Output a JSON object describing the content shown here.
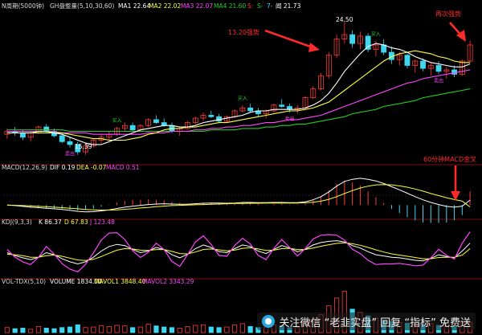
{
  "chart_data": [
    {
      "type": "candlestick",
      "panel": "main",
      "header": {
        "title": "N周期(5000钟)",
        "params": "GH盘整量(5,10,30,60)",
        "ma1": "MA1 22.64",
        "ma2": "MA2 22.02",
        "ma3": "MA3 22.07",
        "ma4": "MA4 21.60",
        "b": "S:",
        "s": "S-",
        "f": "7-",
        "p": "闻 21.73"
      },
      "high_label": "24.50",
      "low_label": "15.39",
      "annotations": [
        "13.20强势",
        "再次强势"
      ],
      "signal_labels": [
        "买入",
        "卖出"
      ],
      "candles": [
        [
          16.8,
          17.2,
          16.5,
          17.0
        ],
        [
          17.0,
          17.3,
          16.7,
          16.9
        ],
        [
          16.9,
          17.1,
          16.4,
          16.6
        ],
        [
          16.6,
          17.0,
          16.3,
          16.9
        ],
        [
          16.9,
          17.4,
          16.8,
          17.3
        ],
        [
          17.3,
          17.5,
          16.9,
          17.0
        ],
        [
          17.0,
          17.2,
          16.6,
          16.7
        ],
        [
          16.7,
          16.9,
          16.2,
          16.3
        ],
        [
          16.3,
          16.6,
          15.9,
          16.1
        ],
        [
          16.1,
          16.3,
          15.4,
          15.6
        ],
        [
          15.6,
          16.2,
          15.4,
          16.0
        ],
        [
          16.0,
          16.5,
          15.9,
          16.4
        ],
        [
          16.4,
          16.8,
          16.2,
          16.6
        ],
        [
          16.6,
          17.0,
          16.4,
          16.8
        ],
        [
          16.8,
          17.3,
          16.7,
          17.2
        ],
        [
          17.2,
          17.6,
          17.0,
          17.4
        ],
        [
          17.4,
          17.6,
          17.0,
          17.1
        ],
        [
          17.1,
          17.5,
          17.0,
          17.4
        ],
        [
          17.4,
          17.9,
          17.3,
          17.8
        ],
        [
          17.8,
          18.1,
          17.5,
          17.6
        ],
        [
          17.6,
          17.9,
          17.3,
          17.4
        ],
        [
          17.4,
          17.6,
          16.9,
          17.0
        ],
        [
          17.0,
          17.3,
          16.7,
          17.2
        ],
        [
          17.2,
          17.7,
          17.1,
          17.6
        ],
        [
          17.6,
          18.0,
          17.5,
          17.9
        ],
        [
          17.9,
          18.3,
          17.7,
          18.1
        ],
        [
          18.1,
          18.4,
          17.9,
          18.0
        ],
        [
          18.0,
          18.2,
          17.6,
          17.7
        ],
        [
          17.7,
          18.1,
          17.6,
          18.0
        ],
        [
          18.0,
          18.5,
          17.9,
          18.4
        ],
        [
          18.4,
          18.8,
          18.3,
          18.6
        ],
        [
          18.6,
          18.9,
          18.3,
          18.4
        ],
        [
          18.4,
          18.6,
          18.0,
          18.2
        ],
        [
          18.2,
          18.5,
          17.9,
          18.4
        ],
        [
          18.4,
          18.9,
          18.3,
          18.8
        ],
        [
          18.8,
          19.2,
          18.6,
          18.7
        ],
        [
          18.7,
          18.9,
          18.3,
          18.5
        ],
        [
          18.5,
          18.8,
          18.2,
          18.6
        ],
        [
          18.6,
          19.4,
          18.5,
          19.3
        ],
        [
          19.3,
          20.1,
          19.2,
          19.9
        ],
        [
          19.9,
          21.0,
          19.8,
          20.8
        ],
        [
          20.8,
          22.4,
          20.6,
          22.2
        ],
        [
          22.2,
          23.6,
          22.0,
          23.3
        ],
        [
          23.3,
          24.5,
          23.0,
          23.6
        ],
        [
          23.6,
          23.9,
          22.7,
          23.0
        ],
        [
          23.0,
          23.8,
          22.6,
          23.5
        ],
        [
          23.5,
          23.7,
          22.4,
          22.6
        ],
        [
          22.6,
          23.2,
          22.1,
          22.9
        ],
        [
          22.9,
          23.3,
          22.2,
          22.4
        ],
        [
          22.4,
          22.8,
          21.6,
          21.9
        ],
        [
          21.9,
          22.4,
          21.5,
          22.2
        ],
        [
          22.2,
          22.3,
          21.3,
          21.5
        ],
        [
          21.5,
          21.9,
          21.0,
          21.8
        ],
        [
          21.8,
          22.0,
          21.1,
          21.3
        ],
        [
          21.3,
          21.7,
          20.8,
          21.5
        ],
        [
          21.5,
          21.8,
          20.9,
          21.1
        ],
        [
          21.1,
          21.4,
          20.6,
          21.2
        ],
        [
          21.2,
          21.5,
          20.7,
          20.9
        ],
        [
          20.9,
          21.9,
          20.8,
          21.8
        ],
        [
          21.8,
          23.2,
          21.7,
          22.9
        ]
      ],
      "ma5": [
        16.9,
        16.9,
        16.9,
        16.9,
        17.0,
        17.0,
        16.9,
        16.8,
        16.6,
        16.4,
        16.2,
        16.1,
        16.1,
        16.3,
        16.5,
        16.7,
        16.9,
        17.1,
        17.2,
        17.3,
        17.4,
        17.4,
        17.3,
        17.3,
        17.4,
        17.6,
        17.7,
        17.8,
        17.9,
        18.0,
        18.1,
        18.3,
        18.4,
        18.4,
        18.5,
        18.5,
        18.5,
        18.5,
        18.6,
        18.8,
        19.1,
        19.6,
        20.3,
        21.1,
        21.7,
        22.3,
        22.8,
        23.0,
        22.9,
        22.7,
        22.6,
        22.4,
        22.1,
        21.9,
        21.7,
        21.6,
        21.5,
        21.4,
        21.4,
        21.6
      ],
      "ma10": [
        16.9,
        16.9,
        16.9,
        16.9,
        16.9,
        16.9,
        16.9,
        16.9,
        16.8,
        16.7,
        16.6,
        16.5,
        16.5,
        16.4,
        16.4,
        16.4,
        16.5,
        16.6,
        16.8,
        16.9,
        17.1,
        17.2,
        17.2,
        17.3,
        17.3,
        17.4,
        17.5,
        17.6,
        17.6,
        17.7,
        17.8,
        17.9,
        18.0,
        18.1,
        18.2,
        18.3,
        18.4,
        18.4,
        18.5,
        18.6,
        18.8,
        19.0,
        19.4,
        19.8,
        20.2,
        20.6,
        21.0,
        21.4,
        21.8,
        22.1,
        22.3,
        22.4,
        22.5,
        22.4,
        22.3,
        22.1,
        22.0,
        21.8,
        21.7,
        21.7
      ],
      "ma30": [
        17.0,
        17.0,
        17.0,
        17.0,
        17.0,
        17.0,
        17.0,
        16.9,
        16.9,
        16.9,
        16.9,
        16.8,
        16.8,
        16.8,
        16.8,
        16.8,
        16.8,
        16.8,
        16.9,
        16.9,
        16.9,
        17.0,
        17.0,
        17.0,
        17.1,
        17.1,
        17.2,
        17.2,
        17.3,
        17.3,
        17.4,
        17.4,
        17.5,
        17.6,
        17.6,
        17.7,
        17.8,
        17.8,
        17.9,
        18.0,
        18.1,
        18.3,
        18.5,
        18.7,
        18.9,
        19.1,
        19.3,
        19.5,
        19.7,
        19.9,
        20.1,
        20.3,
        20.4,
        20.6,
        20.7,
        20.8,
        20.9,
        21.0,
        21.1,
        21.2
      ],
      "ma60": [
        17.1,
        17.1,
        17.1,
        17.1,
        17.1,
        17.1,
        17.1,
        17.1,
        17.0,
        17.0,
        17.0,
        17.0,
        17.0,
        17.0,
        17.0,
        17.0,
        17.0,
        17.0,
        17.0,
        17.0,
        17.0,
        17.0,
        17.0,
        17.0,
        17.0,
        17.0,
        17.1,
        17.1,
        17.1,
        17.1,
        17.2,
        17.2,
        17.2,
        17.3,
        17.3,
        17.4,
        17.4,
        17.5,
        17.5,
        17.6,
        17.7,
        17.8,
        17.9,
        18.0,
        18.2,
        18.3,
        18.4,
        18.5,
        18.7,
        18.8,
        18.9,
        19.0,
        19.1,
        19.3,
        19.4,
        19.5,
        19.6,
        19.7,
        19.8,
        19.9
      ],
      "ylim": [
        15.0,
        25.2
      ]
    },
    {
      "type": "macd",
      "panel": "macd",
      "header": {
        "name": "MACD(12,26,9)",
        "dif": "DIF 0.19",
        "dea": "DEA -0.07",
        "macd": "MACD 0.51"
      },
      "annotation": "60分钟MACD金叉",
      "dif": [
        0.0,
        -0.02,
        -0.05,
        -0.08,
        -0.1,
        -0.12,
        -0.14,
        -0.17,
        -0.2,
        -0.24,
        -0.26,
        -0.25,
        -0.22,
        -0.18,
        -0.13,
        -0.08,
        -0.04,
        -0.01,
        0.02,
        0.04,
        0.05,
        0.04,
        0.03,
        0.03,
        0.05,
        0.07,
        0.08,
        0.08,
        0.07,
        0.08,
        0.1,
        0.1,
        0.09,
        0.09,
        0.1,
        0.1,
        0.09,
        0.09,
        0.12,
        0.2,
        0.32,
        0.5,
        0.72,
        0.9,
        0.98,
        1.02,
        0.98,
        0.92,
        0.82,
        0.7,
        0.58,
        0.45,
        0.32,
        0.2,
        0.1,
        0.02,
        -0.05,
        -0.08,
        -0.04,
        0.19
      ],
      "dea": [
        0.0,
        -0.01,
        -0.02,
        -0.03,
        -0.05,
        -0.06,
        -0.08,
        -0.1,
        -0.12,
        -0.14,
        -0.17,
        -0.18,
        -0.19,
        -0.19,
        -0.18,
        -0.16,
        -0.14,
        -0.11,
        -0.09,
        -0.06,
        -0.04,
        -0.02,
        -0.01,
        0.0,
        0.01,
        0.02,
        0.03,
        0.04,
        0.05,
        0.06,
        0.06,
        0.07,
        0.07,
        0.08,
        0.08,
        0.08,
        0.08,
        0.08,
        0.09,
        0.11,
        0.15,
        0.22,
        0.32,
        0.44,
        0.55,
        0.65,
        0.72,
        0.77,
        0.78,
        0.77,
        0.73,
        0.68,
        0.61,
        0.53,
        0.44,
        0.36,
        0.28,
        0.21,
        0.15,
        -0.07
      ],
      "ylim": [
        -0.45,
        1.2
      ]
    },
    {
      "type": "kdj",
      "panel": "kdj",
      "header": {
        "name": "KDJ(9,3,3)",
        "k": "K 86.37",
        "d": "D 67.83",
        "j": "J 123.48"
      },
      "k": [
        55,
        45,
        38,
        32,
        40,
        55,
        48,
        35,
        25,
        18,
        25,
        40,
        60,
        75,
        82,
        78,
        65,
        55,
        60,
        72,
        65,
        48,
        38,
        50,
        68,
        80,
        72,
        58,
        55,
        68,
        80,
        75,
        60,
        52,
        65,
        78,
        70,
        58,
        66,
        80,
        88,
        92,
        94,
        90,
        78,
        70,
        58,
        48,
        44,
        40,
        38,
        34,
        30,
        28,
        36,
        48,
        42,
        38,
        60,
        86
      ],
      "d": [
        50,
        48,
        45,
        40,
        40,
        45,
        47,
        43,
        37,
        31,
        29,
        33,
        42,
        53,
        63,
        68,
        67,
        63,
        62,
        65,
        65,
        59,
        52,
        51,
        57,
        65,
        67,
        64,
        61,
        63,
        69,
        71,
        67,
        62,
        63,
        68,
        69,
        65,
        65,
        70,
        76,
        81,
        85,
        87,
        84,
        79,
        72,
        64,
        57,
        51,
        47,
        43,
        39,
        35,
        35,
        39,
        40,
        40,
        47,
        68
      ],
      "j": [
        65,
        40,
        25,
        16,
        40,
        75,
        50,
        19,
        1,
        -8,
        17,
        54,
        96,
        119,
        120,
        98,
        61,
        39,
        56,
        86,
        65,
        26,
        10,
        48,
        90,
        110,
        82,
        46,
        43,
        78,
        102,
        83,
        46,
        32,
        69,
        98,
        72,
        44,
        68,
        100,
        112,
        114,
        112,
        96,
        66,
        52,
        30,
        16,
        18,
        18,
        20,
        16,
        12,
        14,
        38,
        66,
        46,
        34,
        86,
        123
      ],
      "ylim": [
        -20,
        135
      ]
    },
    {
      "type": "volume",
      "panel": "volume",
      "header": {
        "name": "VOL-TDX(5,10)",
        "vol": "VOLUME 1834.00",
        "mavol1": "MAVOL1 3848.40",
        "mavol2": "MAVOL2 3343.29"
      },
      "volume": [
        900,
        700,
        800,
        600,
        1100,
        800,
        700,
        900,
        1000,
        1400,
        900,
        1000,
        1200,
        1100,
        1300,
        1200,
        900,
        1000,
        1500,
        1200,
        1000,
        900,
        800,
        1100,
        1300,
        1400,
        1000,
        900,
        1000,
        1400,
        1600,
        1100,
        900,
        1000,
        1400,
        1200,
        900,
        1000,
        1800,
        2400,
        3200,
        4800,
        6200,
        7400,
        4200,
        3600,
        3000,
        2600,
        2200,
        2000,
        1800,
        1700,
        1500,
        1400,
        1600,
        1300,
        1200,
        1100,
        1900,
        1834
      ],
      "ylim": [
        0,
        8200
      ]
    }
  ],
  "watermark": {
    "text": "关注微信 “老韭实盘” 回复 “指标” 免费送"
  },
  "colors": {
    "up": "#ff3b3b",
    "down": "#3fd6f0",
    "ma5": "#ffffff",
    "ma10": "#ffff44",
    "ma30": "#ff44ff",
    "ma60": "#22cc22",
    "dif": "#ffffff",
    "dea": "#ffff33",
    "k": "#ffffff",
    "d": "#ffff33",
    "j": "#ff44ff",
    "label": "#ff2a2a",
    "grid": "#7a1010"
  }
}
